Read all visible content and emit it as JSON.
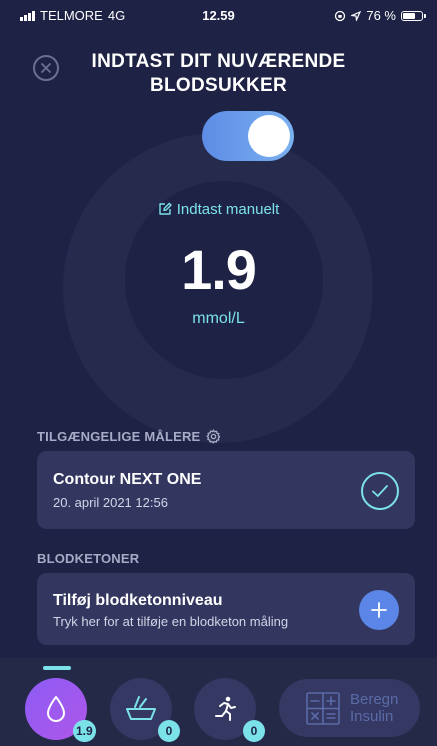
{
  "status_bar": {
    "carrier": "TELMORE",
    "network": "4G",
    "time": "12.59",
    "battery_text": "76 %",
    "battery_level": 0.76
  },
  "header": {
    "title_line1": "INDTAST DIT NUVÆRENDE",
    "title_line2": "BLODSUKKER",
    "close_icon": "close-icon"
  },
  "measurement": {
    "toggle_on": true,
    "manual_label": "Indtast manuelt",
    "value": "1.9",
    "unit": "mmol/L"
  },
  "meters": {
    "section_label": "TILGÆNGELIGE MÅLERE",
    "device_name": "Contour NEXT ONE",
    "device_date": "20. april 2021 12:56",
    "selected": true
  },
  "ketones": {
    "section_label": "BLODKETONER",
    "card_title": "Tilføj blodketonniveau",
    "card_subtitle": "Tryk her for at tilføje en blodketon måling"
  },
  "bottom_nav": {
    "blood_badge": "1.9",
    "food_badge": "0",
    "exercise_badge": "0",
    "calc_label_line1": "Beregn",
    "calc_label_line2": "Insulin"
  },
  "colors": {
    "background": "#1e2245",
    "accent_cyan": "#7ce2ea",
    "card": "#333760",
    "button_blue": "#5b86e8",
    "active_tab": "#8b5cf5"
  }
}
